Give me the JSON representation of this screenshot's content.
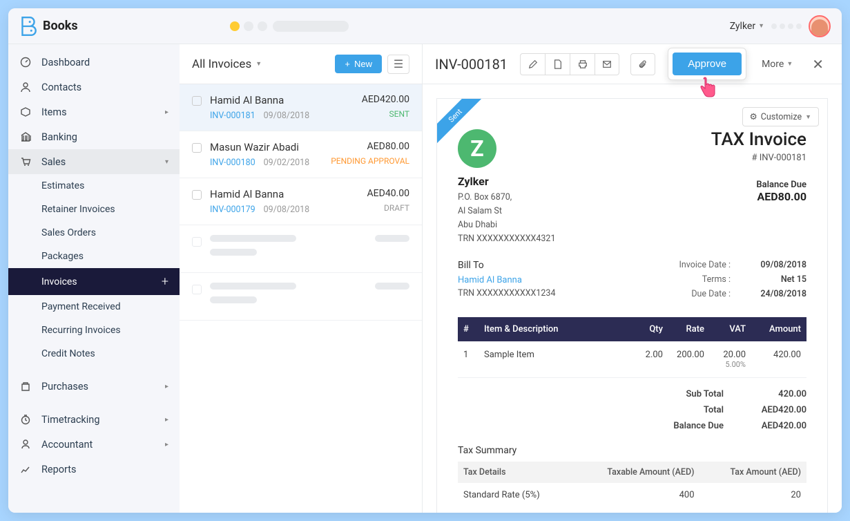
{
  "app": {
    "name": "Books"
  },
  "topbar": {
    "org": "Zylker"
  },
  "sidebar": {
    "dashboard": "Dashboard",
    "contacts": "Contacts",
    "items": "Items",
    "banking": "Banking",
    "sales": "Sales",
    "estimates": "Estimates",
    "retainer_invoices": "Retainer Invoices",
    "sales_orders": "Sales Orders",
    "packages": "Packages",
    "invoices": "Invoices",
    "payment_received": "Payment Received",
    "recurring_invoices": "Recurring Invoices",
    "credit_notes": "Credit Notes",
    "purchases": "Purchases",
    "timetracking": "Timetracking",
    "accountant": "Accountant",
    "reports": "Reports"
  },
  "list": {
    "title": "All Invoices",
    "new": "New",
    "items": [
      {
        "name": "Hamid Al Banna",
        "num": "INV-000181",
        "date": "09/08/2018",
        "amt": "AED420.00",
        "status": "SENT",
        "status_cls": "sent"
      },
      {
        "name": "Masun Wazir Abadi",
        "num": "INV-000180",
        "date": "09/02/2018",
        "amt": "AED80.00",
        "status": "PENDING APPROVAL",
        "status_cls": "pending"
      },
      {
        "name": "Hamid Al Banna",
        "num": "INV-000179",
        "date": "09/08/2018",
        "amt": "AED40.00",
        "status": "DRAFT",
        "status_cls": "draft"
      }
    ]
  },
  "detail": {
    "title": "INV-000181",
    "approve": "Approve",
    "more": "More",
    "customize": "Customize",
    "ribbon": "Sent",
    "logo_letter": "Z",
    "company": {
      "name": "Zylker",
      "line1": "P.O. Box 6870,",
      "line2": "Al Salam St",
      "line3": "Abu Dhabi",
      "trn": "TRN XXXXXXXXXXX4321"
    },
    "doc_title": "TAX Invoice",
    "doc_num": "# INV-000181",
    "balance_label": "Balance Due",
    "balance_amt": "AED80.00",
    "bill_to_label": "Bill To",
    "bill_to_name": "Hamid Al Banna",
    "bill_to_trn": "TRN XXXXXXXXXXX1234",
    "meta": {
      "inv_date_lbl": "Invoice Date :",
      "inv_date": "09/08/2018",
      "terms_lbl": "Terms :",
      "terms": "Net 15",
      "due_lbl": "Due Date :",
      "due": "24/08/2018"
    },
    "cols": {
      "num": "#",
      "item": "Item & Description",
      "qty": "Qty",
      "rate": "Rate",
      "vat": "VAT",
      "amount": "Amount"
    },
    "rows": [
      {
        "n": "1",
        "item": "Sample Item",
        "qty": "2.00",
        "rate": "200.00",
        "vat": "20.00",
        "vat_rate": "5.00%",
        "amount": "420.00"
      }
    ],
    "totals": {
      "subtotal_lbl": "Sub Total",
      "subtotal": "420.00",
      "total_lbl": "Total",
      "total": "AED420.00",
      "balance_lbl": "Balance Due",
      "balance": "AED420.00"
    },
    "tax": {
      "title": "Tax Summary",
      "col1": "Tax Details",
      "col2": "Taxable Amount (AED)",
      "col3": "Tax Amount (AED)",
      "row": {
        "name": "Standard Rate (5%)",
        "taxable": "400",
        "tax": "20"
      }
    }
  }
}
